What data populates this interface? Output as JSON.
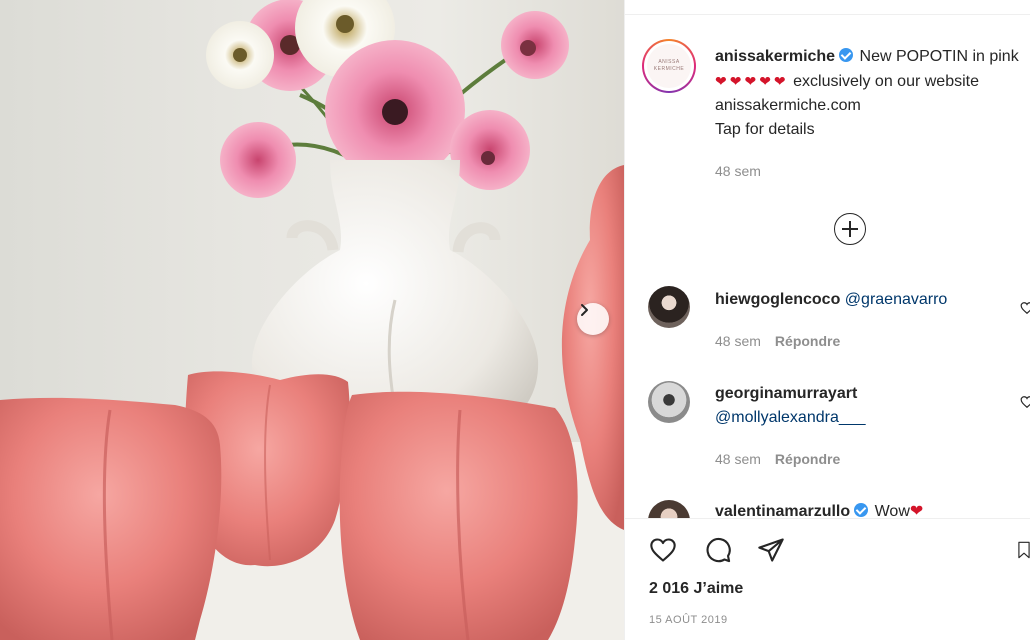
{
  "post": {
    "author": "anissakermiche",
    "caption_lines": [
      "New POPOTIN in",
      "pink",
      "exclusively on",
      "our website anissakermiche.com",
      "Tap for details"
    ],
    "hearts": "❤❤❤❤❤",
    "posted_ago": "48 sem",
    "avatar_logo_text": "ANISSA KERMICHE"
  },
  "comments": [
    {
      "username": "hiewgoglencoco",
      "text": "@graenavarro",
      "time": "48 sem",
      "reply_label": "Répondre"
    },
    {
      "username": "georginamurrayart",
      "text": "@mollyalexandra___",
      "time": "48 sem",
      "reply_label": "Répondre"
    },
    {
      "username": "valentinamarzullo",
      "text": "Wow",
      "emoji": "❤"
    }
  ],
  "footer": {
    "likes": "2 016 J’aime",
    "date": "15 AOÛT 2019"
  },
  "icons": {
    "like": "heart-outline-icon",
    "comment": "speech-bubble-icon",
    "share": "paper-plane-icon",
    "save": "bookmark-icon",
    "next": "chevron-right-icon",
    "more": "plus-circle-icon",
    "verified": "verified-badge-icon"
  },
  "colors": {
    "vase_pink": "#e87f7a",
    "vase_white": "#f1efea",
    "verified_blue": "#3897f0",
    "mention_blue": "#00376b",
    "muted_text": "#8e8e8e"
  }
}
